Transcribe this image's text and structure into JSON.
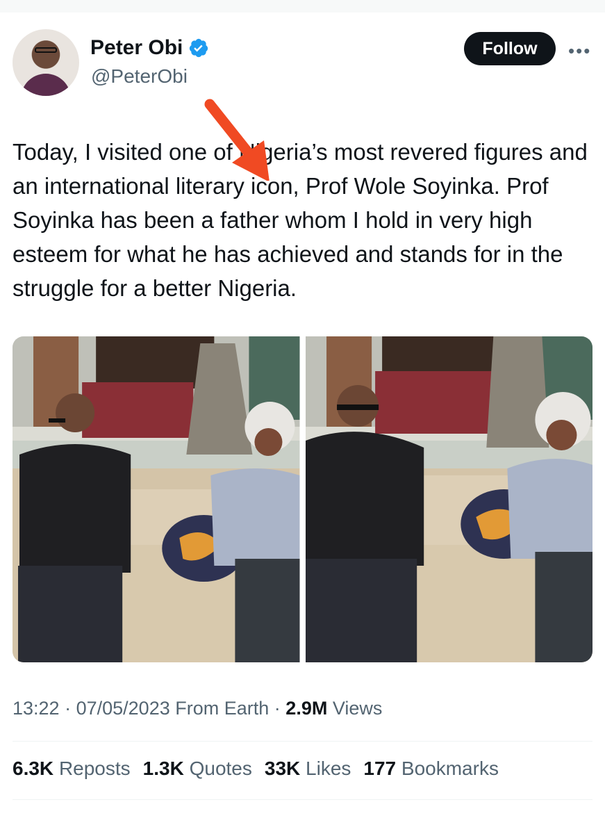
{
  "author": {
    "display_name": "Peter Obi",
    "handle": "@PeterObi",
    "verified": true
  },
  "actions": {
    "follow_label": "Follow",
    "more_label": "•••"
  },
  "tweet": {
    "text": "Today, I visited one of Nigeria’s most revered figures and an international literary icon, Prof Wole Soyinka. Prof Soyinka has been a father whom I hold in very high esteem for what he has achieved and stands for in the struggle for a better Nigeria."
  },
  "meta": {
    "time": "13:22",
    "date": "07/05/2023",
    "source": "From Earth",
    "views_count": "2.9M",
    "views_label": "Views"
  },
  "stats": {
    "reposts_count": "6.3K",
    "reposts_label": "Reposts",
    "quotes_count": "1.3K",
    "quotes_label": "Quotes",
    "likes_count": "33K",
    "likes_label": "Likes",
    "bookmarks_count": "177",
    "bookmarks_label": "Bookmarks"
  },
  "colors": {
    "text": "#0f1419",
    "secondary": "#536471",
    "verified": "#1d9bf0",
    "arrow": "#f04a23"
  }
}
